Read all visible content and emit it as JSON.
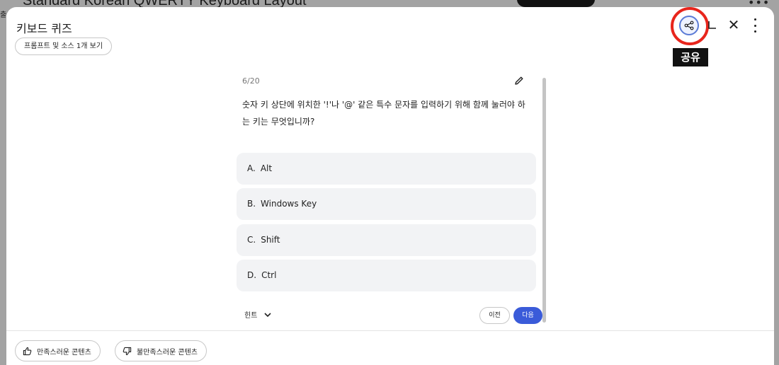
{
  "background": {
    "title": "Standard Korean QWERTY Keyboard Layout",
    "left_text": "출"
  },
  "modal": {
    "title": "키보드 퀴즈",
    "source_chip": "프롬프트 및 소스 1개 보기",
    "tooltip": "공유"
  },
  "quiz": {
    "counter": "6/20",
    "question": "숫자 키 상단에 위치한 '!'나 '@' 같은 특수 문자를 입력하기 위해 함께 눌러야 하는 키는 무엇입니까?",
    "options": [
      {
        "letter": "A.",
        "text": "Alt"
      },
      {
        "letter": "B.",
        "text": "Windows Key"
      },
      {
        "letter": "C.",
        "text": "Shift"
      },
      {
        "letter": "D.",
        "text": "Ctrl"
      }
    ],
    "hint_label": "힌트",
    "prev_label": "이전",
    "next_label": "다음"
  },
  "feedback": {
    "good_label": "만족스러운 콘텐츠",
    "bad_label": "불만족스러운 콘텐츠"
  },
  "colors": {
    "accent": "#3a5bd9",
    "highlight": "#e8251c"
  }
}
